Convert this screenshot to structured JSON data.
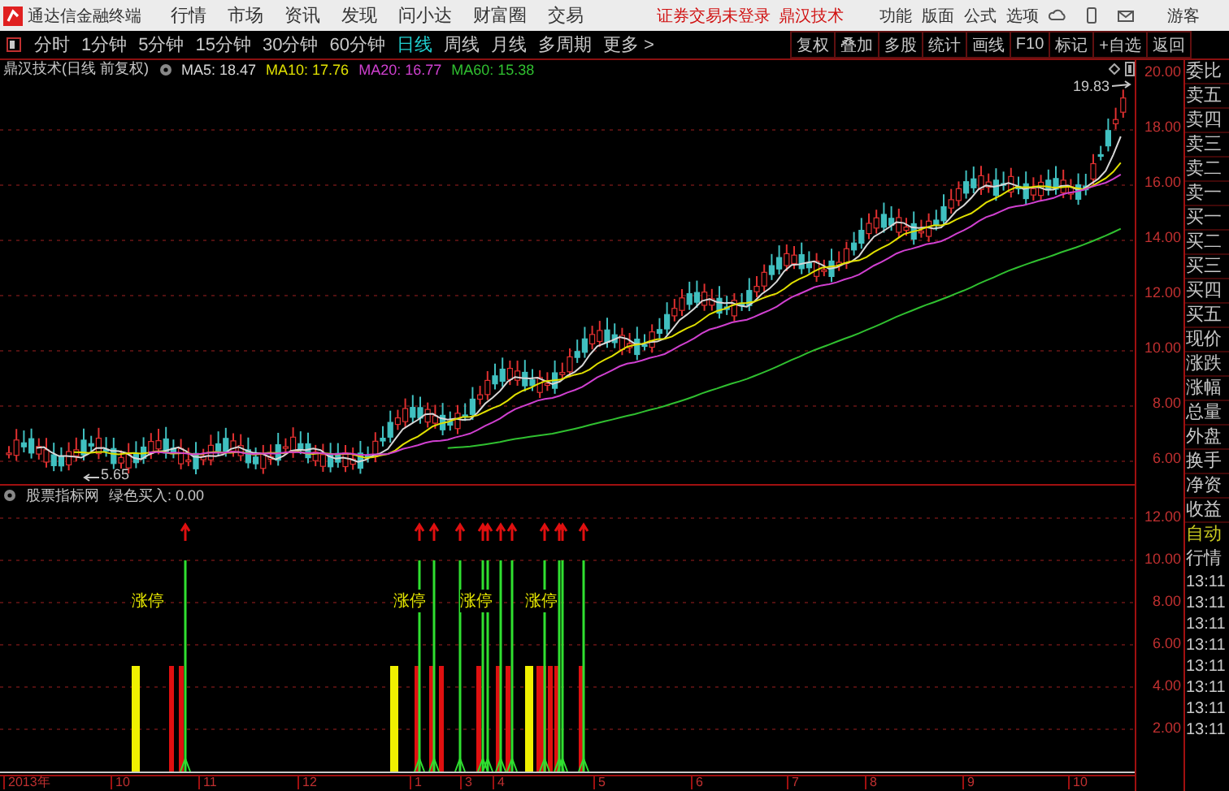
{
  "app": {
    "title": "通达信金融终端"
  },
  "menu": [
    "行情",
    "市场",
    "资讯",
    "发现",
    "问小达",
    "财富圈",
    "交易"
  ],
  "login_notice": "证券交易未登录",
  "top_stock": "鼎汉技术",
  "top_menu": [
    "功能",
    "版面",
    "公式",
    "选项"
  ],
  "user": "游客",
  "periods": [
    {
      "label": "分时",
      "selected": false
    },
    {
      "label": "1分钟",
      "selected": false
    },
    {
      "label": "5分钟",
      "selected": false
    },
    {
      "label": "15分钟",
      "selected": false
    },
    {
      "label": "30分钟",
      "selected": false
    },
    {
      "label": "60分钟",
      "selected": false
    },
    {
      "label": "日线",
      "selected": true
    },
    {
      "label": "周线",
      "selected": false
    },
    {
      "label": "月线",
      "selected": false
    },
    {
      "label": "多周期",
      "selected": false
    },
    {
      "label": "更多 >",
      "selected": false
    }
  ],
  "tools": [
    "复权",
    "叠加",
    "多股",
    "统计",
    "画线",
    "F10",
    "标记",
    "+自选",
    "返回"
  ],
  "chart": {
    "title": "鼎汉技术(日线 前复权)",
    "ma": [
      {
        "label": "MA5: 18.47",
        "color": "#d8d8d8"
      },
      {
        "label": "MA10: 17.76",
        "color": "#e0e000"
      },
      {
        "label": "MA20: 16.77",
        "color": "#d040d0"
      },
      {
        "label": "MA60: 15.38",
        "color": "#30c030"
      }
    ],
    "high_label": "19.83",
    "low_label": "5.65",
    "y_labels": [
      "20.00",
      "18.00",
      "16.00",
      "14.00",
      "12.00",
      "10.00",
      "8.00",
      "6.00"
    ]
  },
  "indicator": {
    "title": "股票指标网",
    "reading": "绿色买入: 0.00",
    "labels": [
      "涨停",
      "涨停",
      "涨停",
      "涨停"
    ],
    "y_labels": [
      "12.00",
      "10.00",
      "8.00",
      "6.00",
      "4.00",
      "2.00"
    ]
  },
  "x_axis": [
    "2013年",
    "10",
    "11",
    "12",
    "1",
    "3",
    "4",
    "5",
    "6",
    "7",
    "8",
    "9",
    "10"
  ],
  "quote_panel": {
    "labels": [
      "委比",
      "卖五",
      "卖四",
      "卖三",
      "卖二",
      "卖一",
      "买一",
      "买二",
      "买三",
      "买四",
      "买五",
      "现价",
      "涨跌",
      "涨幅",
      "总量",
      "外盘",
      "换手",
      "净资",
      "收益"
    ],
    "mode": [
      "自动",
      "行情"
    ],
    "times": [
      "13:11",
      "13:11",
      "13:11",
      "13:11",
      "13:11",
      "13:11",
      "13:11",
      "13:11"
    ]
  }
}
